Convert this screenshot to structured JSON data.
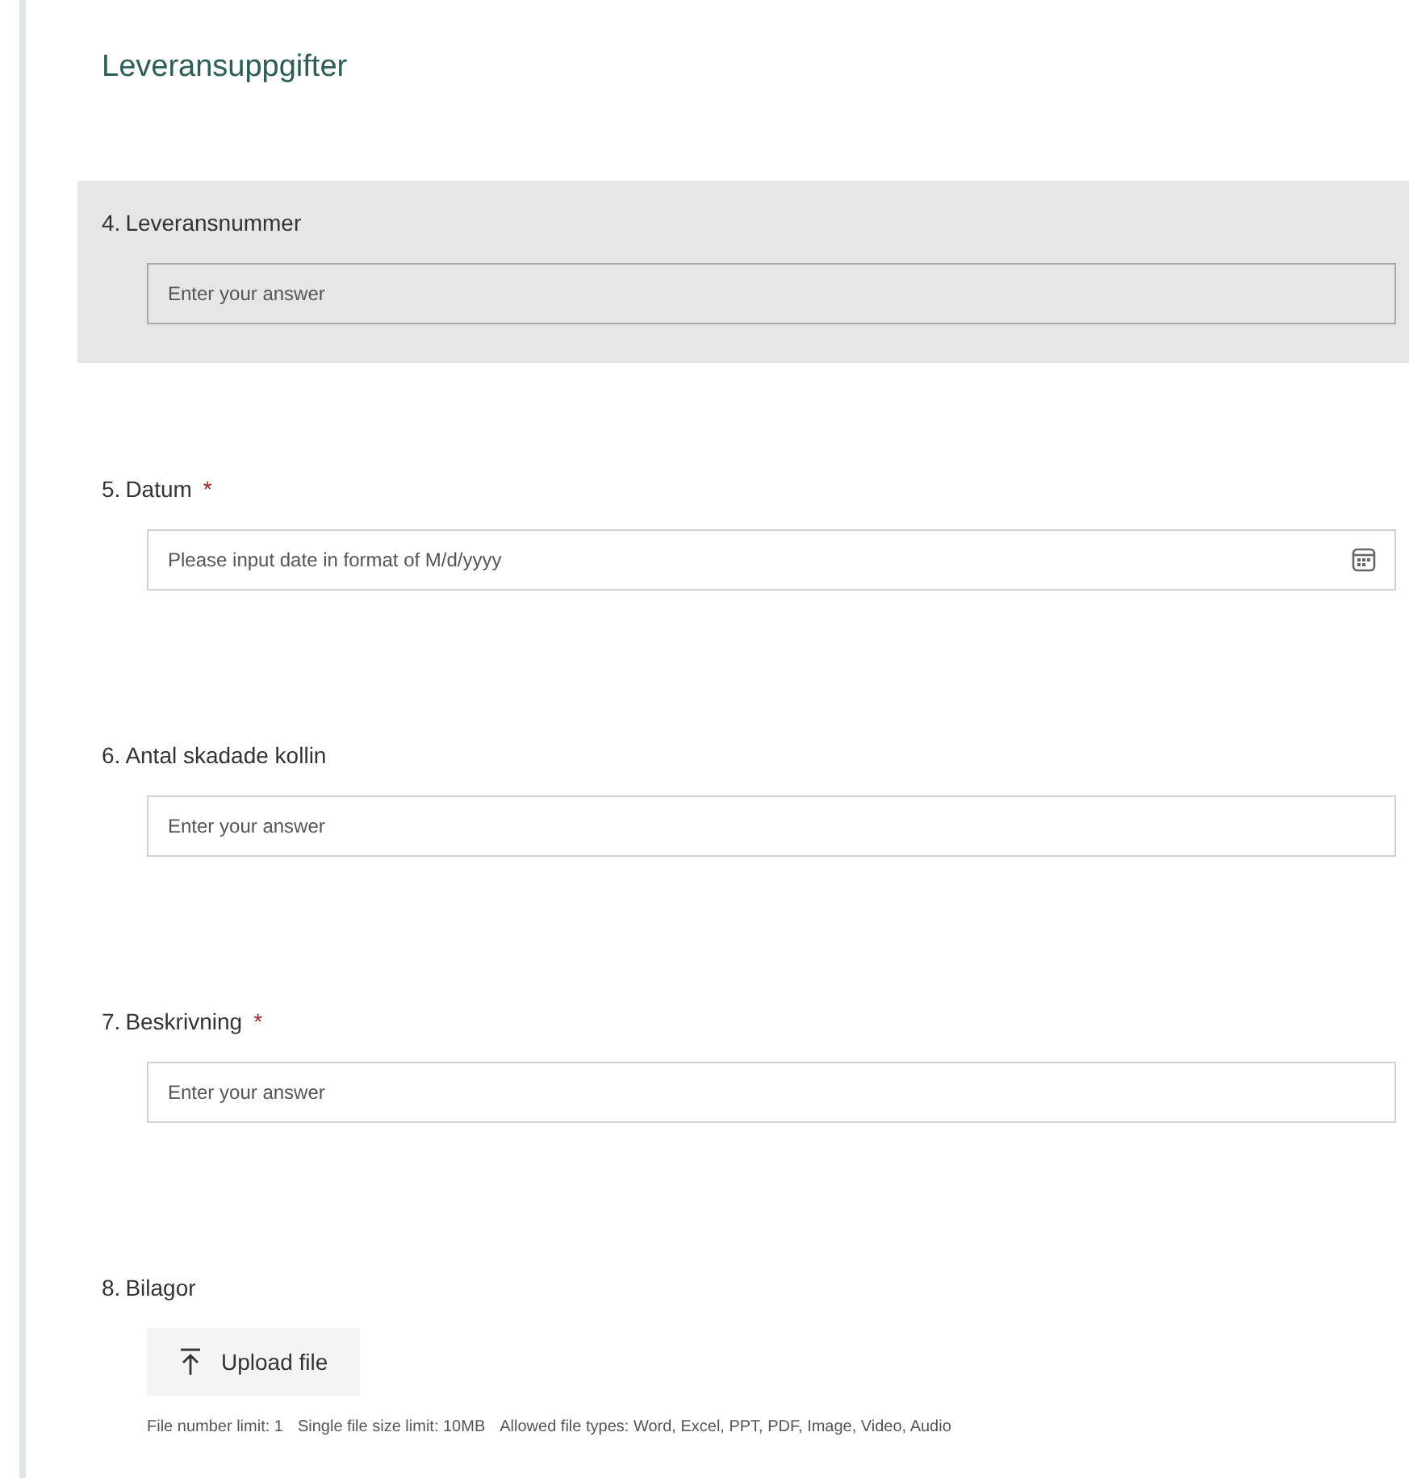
{
  "section_title": "Leveransuppgifter",
  "required_mark": "*",
  "questions": [
    {
      "kind": "text",
      "number": "4.",
      "label": "Leveransnummer",
      "required": false,
      "highlighted": true,
      "placeholder": "Enter your answer"
    },
    {
      "kind": "date",
      "number": "5.",
      "label": "Datum",
      "required": true,
      "highlighted": false,
      "placeholder": "Please input date in format of M/d/yyyy"
    },
    {
      "kind": "text",
      "number": "6.",
      "label": "Antal skadade kollin",
      "required": false,
      "highlighted": false,
      "placeholder": "Enter your answer"
    },
    {
      "kind": "text",
      "number": "7.",
      "label": "Beskrivning",
      "required": true,
      "highlighted": false,
      "placeholder": "Enter your answer"
    },
    {
      "kind": "upload",
      "number": "8.",
      "label": "Bilagor",
      "required": false,
      "highlighted": false,
      "button": "Upload file",
      "limits": [
        "File number limit: 1",
        "Single file size limit: 10MB",
        "Allowed file types: Word, Excel, PPT, PDF, Image, Video, Audio"
      ]
    }
  ]
}
